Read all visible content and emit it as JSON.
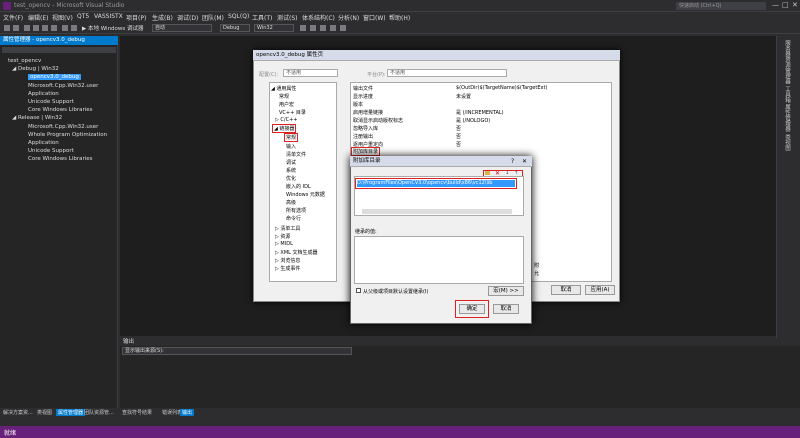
{
  "window": {
    "title": "test_opencv - Microsoft Visual Studio",
    "quick_launch": "快速启动 (Ctrl+Q)",
    "minimize": "—",
    "maximize": "□",
    "close": "✕"
  },
  "menu": [
    "文件(F)",
    "编辑(E)",
    "视图(V)",
    "QT5",
    "VASSISTX",
    "项目(P)",
    "生成(B)",
    "调试(D)",
    "团队(M)",
    "SQL(Q)",
    "工具(T)",
    "测试(S)",
    "体系结构(C)",
    "分析(N)",
    "窗口(W)",
    "帮助(H)"
  ],
  "toolbar": {
    "run_label": "▶ 本地 Windows 调试器",
    "mode": "自动",
    "config": "Debug",
    "platform": "Win32"
  },
  "left_panel": {
    "header": "属性管理器 - opencv3.0_debug",
    "items": [
      "test_opencv",
      "◢ Debug | Win32",
      "opencv3.0_debug",
      "Microsoft.Cpp.Win32.user",
      "Application",
      "Unicode Support",
      "Core Windows Libraries",
      "◢ Release | Win32",
      "Microsoft.Cpp.Win32.user",
      "Whole Program Optimization",
      "Application",
      "Unicode Support",
      "Core Windows Libraries"
    ]
  },
  "right_strip": [
    "服务器资源管理器",
    "工具箱",
    "属性管理器",
    "类视图"
  ],
  "dialog": {
    "title": "opencv3.0_debug 属性页",
    "config_label": "配置(C):",
    "config_value": "不适用",
    "platform_label": "平台(P):",
    "platform_value": "不适用",
    "tree": [
      "◢ 通用属性",
      "常规",
      "用户宏",
      "VC++ 目录",
      "▷ C/C++",
      "◢ 链接器",
      "常规",
      "输入",
      "清单文件",
      "调试",
      "系统",
      "优化",
      "嵌入的 IDL",
      "Windows 元数据",
      "高级",
      "所有选项",
      "命令行",
      "▷ 清单工具",
      "▷ 资源",
      "▷ MIDL",
      "▷ XML 文档生成器",
      "▷ 浏览信息",
      "▷ 生成事件"
    ],
    "props": [
      {
        "name": "输出文件",
        "value": "$(OutDir)$(TargetName)$(TargetExt)"
      },
      {
        "name": "显示进度",
        "value": "未设置"
      },
      {
        "name": "版本",
        "value": ""
      },
      {
        "name": "启用增量链接",
        "value": "是 (/INCREMENTAL)"
      },
      {
        "name": "取消显示启动版权标志",
        "value": "是 (/NOLOGO)"
      },
      {
        "name": "忽略导入库",
        "value": "否"
      },
      {
        "name": "注册输出",
        "value": "否"
      },
      {
        "name": "逐用户重定向",
        "value": "否"
      },
      {
        "name": "附加库目录",
        "value": ""
      }
    ],
    "desc_title": "附",
    "desc_text": "允",
    "cancel": "取消",
    "apply": "应用(A)"
  },
  "subdialog": {
    "title": "附加库目录",
    "help": "?",
    "close": "✕",
    "path": "D:\\ProgramFiles\\OpenCV3.0\\opencv\\build\\x86\\vc12\\lib",
    "eval_label": "继承的值:",
    "inherit_label": "从父级或项目默认设置继承(I)",
    "macro_button": "宏(M) >>",
    "ok": "确定",
    "cancel": "取消"
  },
  "output": {
    "header": "输出",
    "source_label": "显示输出来源(S):"
  },
  "bottom_tabs_left": [
    "解决方案资...",
    "类视图",
    "属性管理器",
    "团队资源管..."
  ],
  "bottom_tabs_right": [
    "查找符号结果",
    "错误列表",
    "输出"
  ],
  "status": "就绪"
}
